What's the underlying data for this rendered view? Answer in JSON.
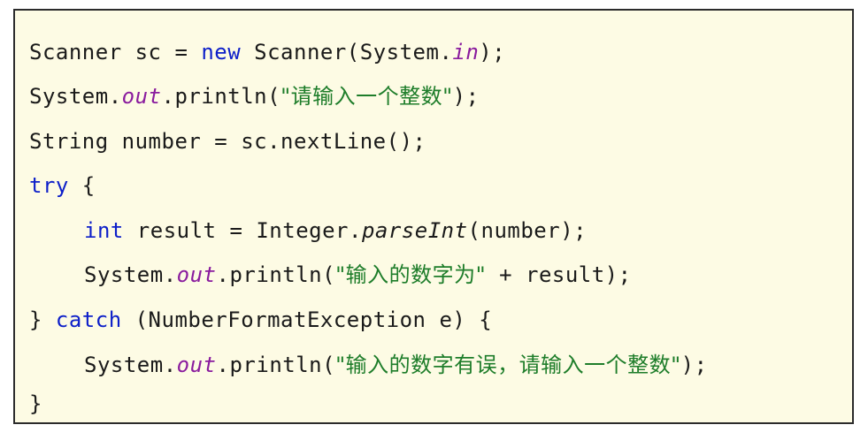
{
  "code": {
    "line1": {
      "t1": "Scanner sc = ",
      "kw_new": "new",
      "t2": " Scanner(System.",
      "field_in": "in",
      "t3": ");"
    },
    "line2": {
      "t1": "System.",
      "field_out": "out",
      "t2": ".println(",
      "str": "\"请输入一个整数\"",
      "t3": ");"
    },
    "line3": {
      "t1": "String number = sc.nextLine();"
    },
    "line4": {
      "kw_try": "try",
      "t1": " {"
    },
    "line5": {
      "kw_int": "int",
      "t1": " result = Integer.",
      "method_parse": "parseInt",
      "t2": "(number);"
    },
    "line6": {
      "t1": "System.",
      "field_out": "out",
      "t2": ".println(",
      "str": "\"输入的数字为\"",
      "t3": " + result);"
    },
    "line7": {
      "t1": "} ",
      "kw_catch": "catch",
      "t2": " (NumberFormatException e) {"
    },
    "line8": {
      "t1": "System.",
      "field_out": "out",
      "t2": ".println(",
      "str": "\"输入的数字有误，请输入一个整数\"",
      "t3": ");"
    },
    "line9": {
      "t1": "}"
    }
  },
  "colors": {
    "background": "#fdfbe4",
    "keyword": "#0d1fc9",
    "static_field": "#8a1c9e",
    "string": "#1e7d2a",
    "text": "#1a1a1a"
  }
}
